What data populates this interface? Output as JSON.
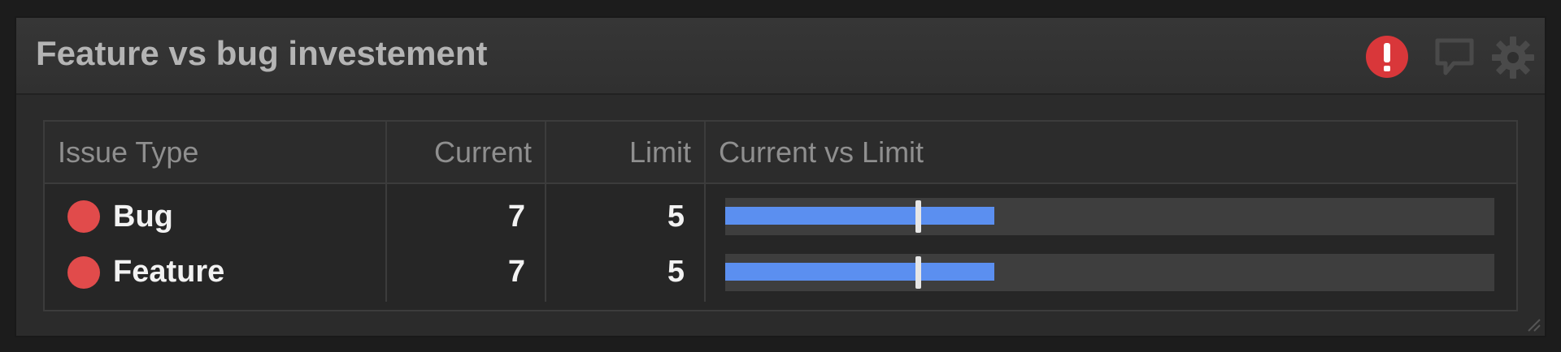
{
  "widget": {
    "title": "Feature vs bug investement",
    "icons": [
      "alert-icon",
      "comment-icon",
      "gear-icon"
    ],
    "accent_alert_color": "#d9373a"
  },
  "table": {
    "columns": [
      "Issue Type",
      "Current",
      "Limit",
      "Current vs Limit"
    ],
    "bar_max": 20,
    "rows": [
      {
        "type": "Bug",
        "current": "7",
        "limit": "5",
        "current_value": 7,
        "limit_value": 5,
        "dot_color": "#e14b4b"
      },
      {
        "type": "Feature",
        "current": "7",
        "limit": "5",
        "current_value": 7,
        "limit_value": 5,
        "dot_color": "#e14b4b"
      }
    ],
    "bar_color": "#5b8ff0"
  }
}
